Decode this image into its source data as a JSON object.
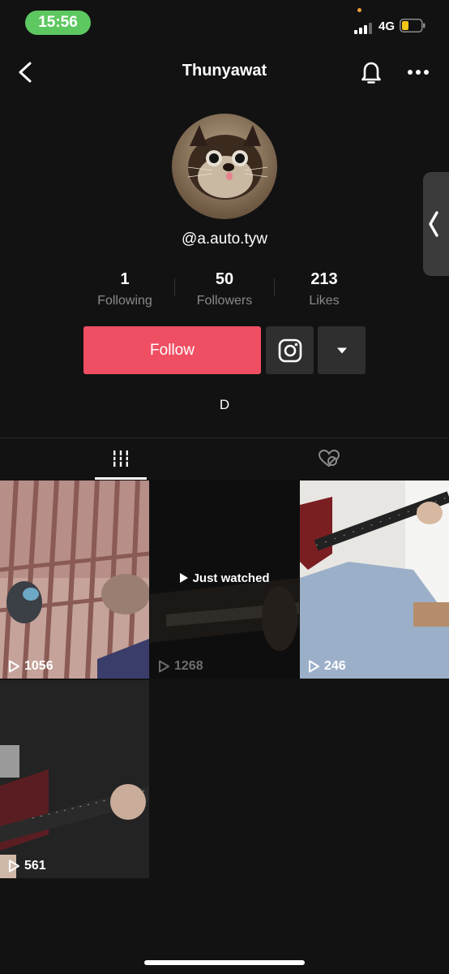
{
  "status_bar": {
    "time": "15:56",
    "network": "4G"
  },
  "header": {
    "title": "Thunyawat"
  },
  "profile": {
    "username": "@a.auto.tyw",
    "stats": [
      {
        "value": "1",
        "label": "Following"
      },
      {
        "value": "50",
        "label": "Followers"
      },
      {
        "value": "213",
        "label": "Likes"
      }
    ],
    "follow_label": "Follow",
    "bio": "D"
  },
  "videos": [
    {
      "count": "1056"
    },
    {
      "count": "1268",
      "overlay": "Just watched"
    },
    {
      "count": "246"
    },
    {
      "count": "561"
    }
  ],
  "colors": {
    "accent": "#ef4e63",
    "background": "#121212",
    "status_pill": "#5dc860"
  }
}
